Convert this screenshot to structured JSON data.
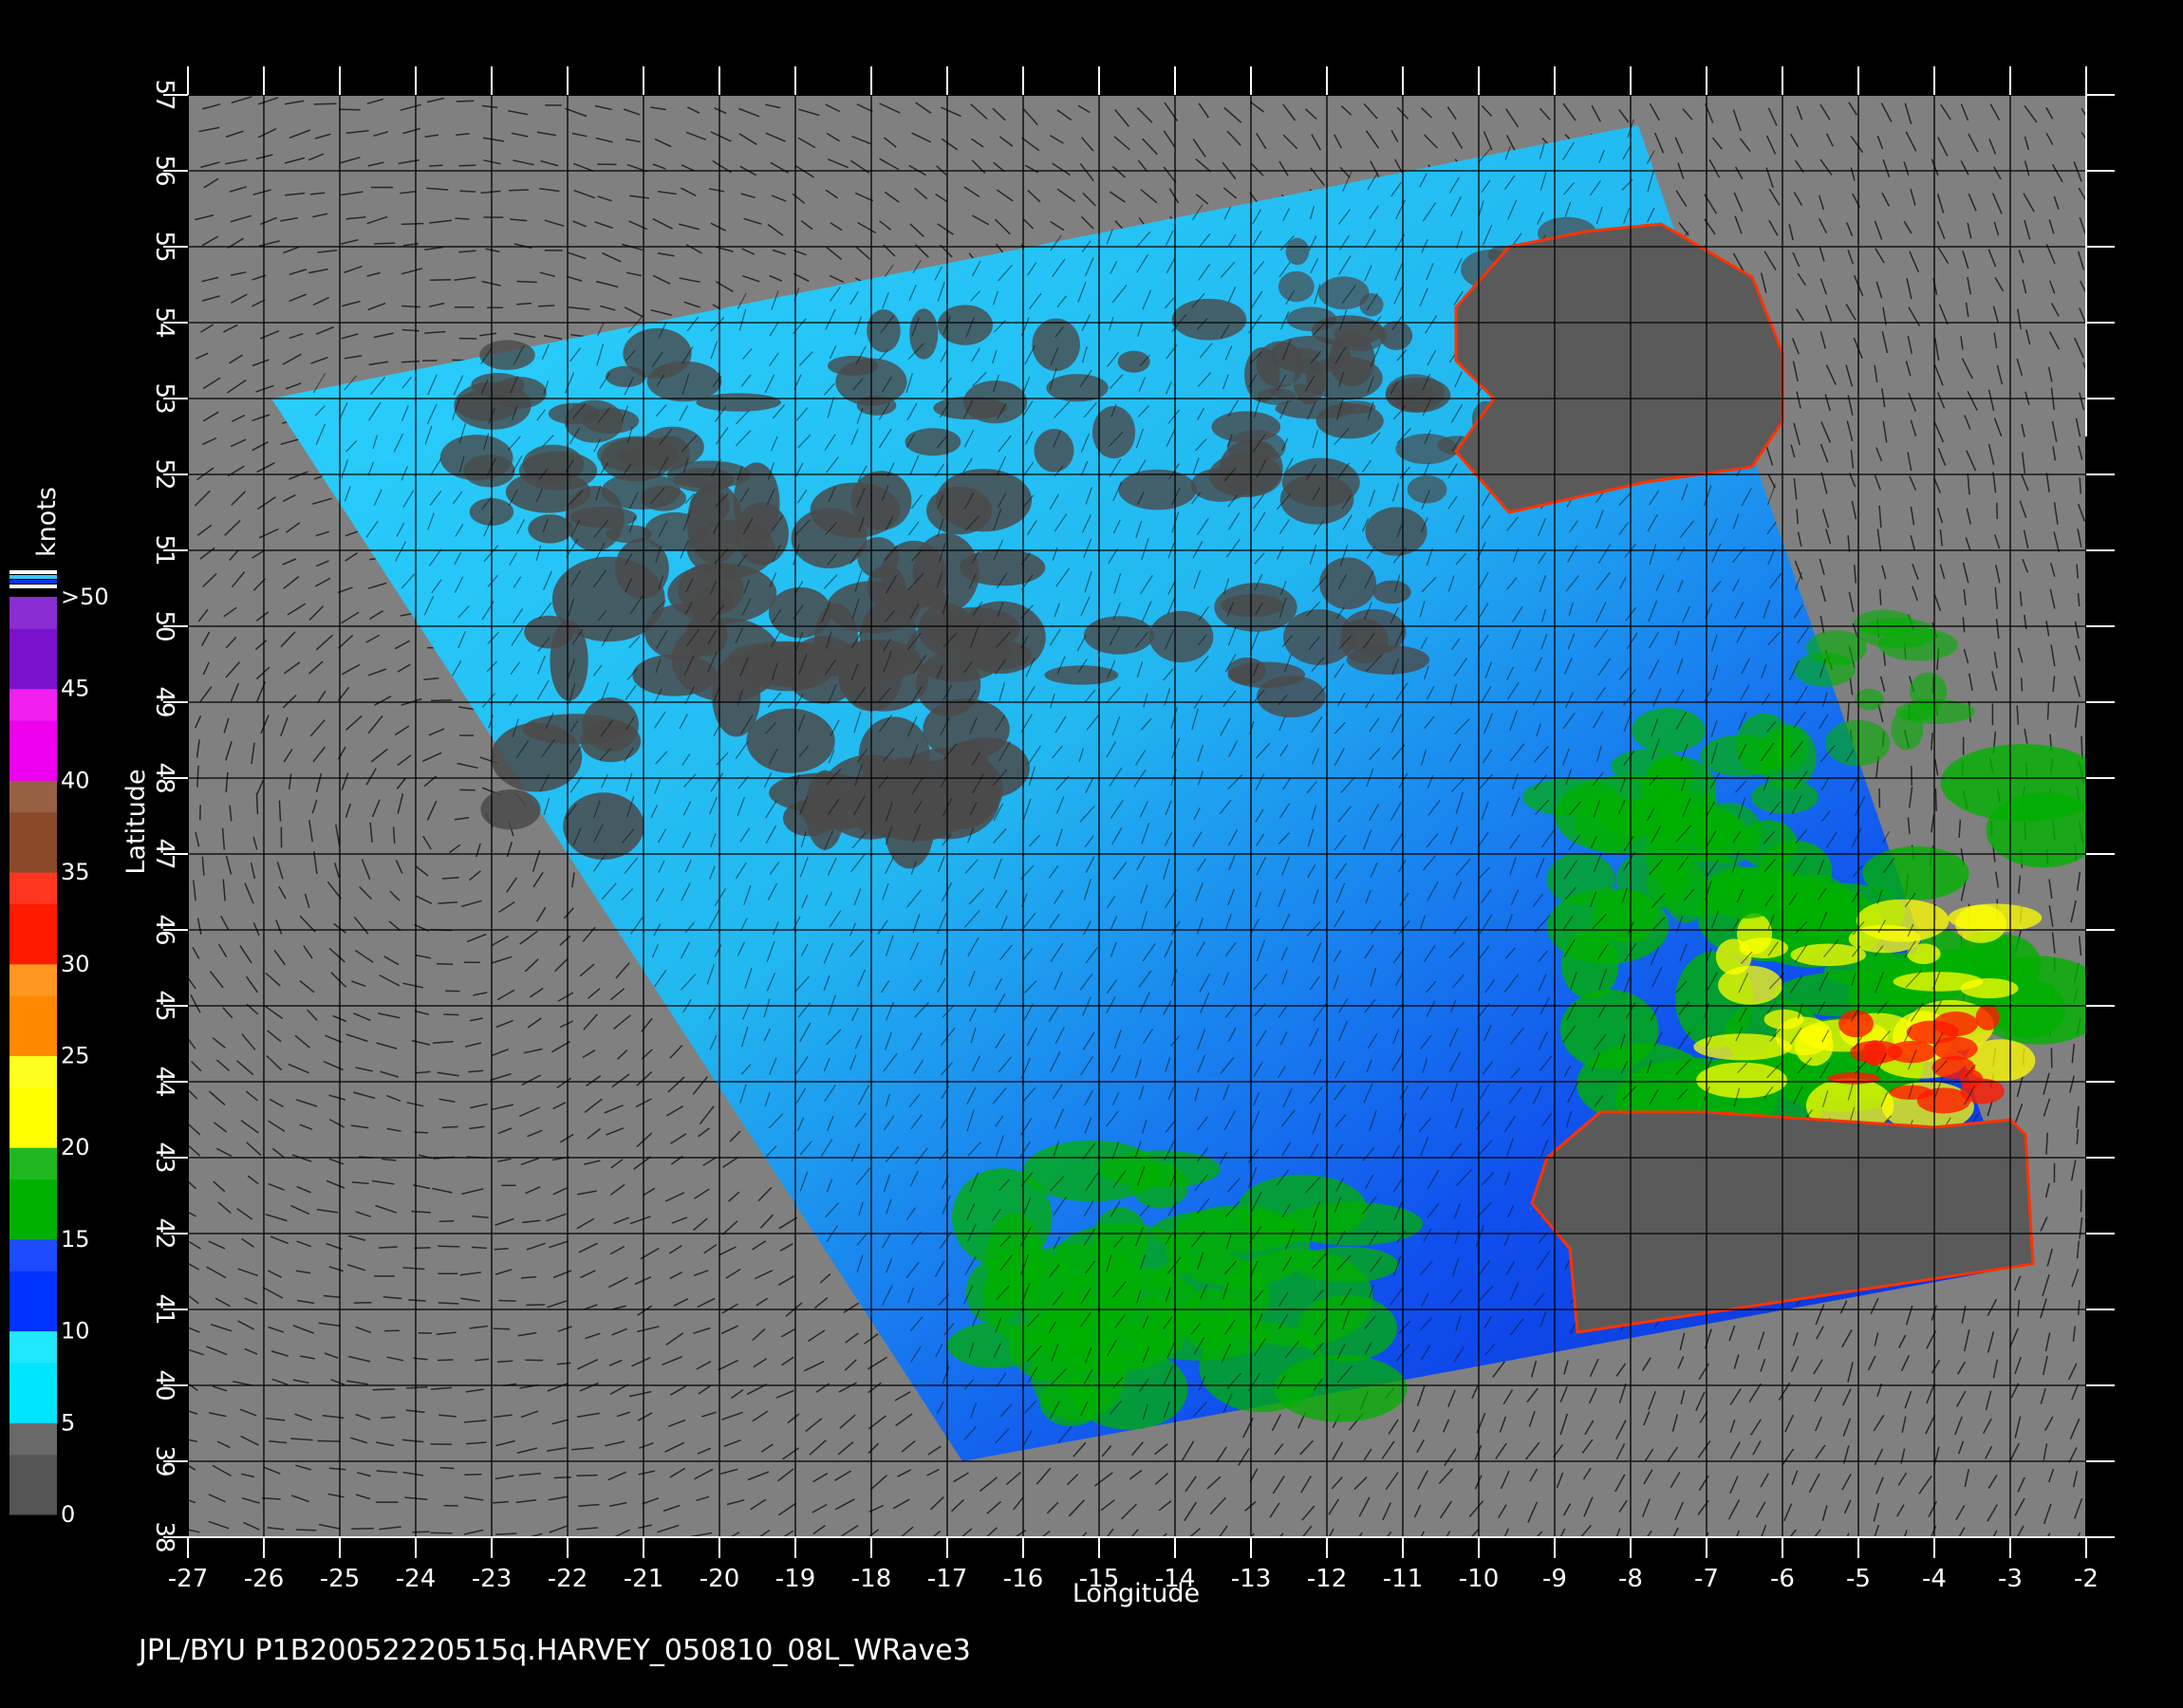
{
  "map": {
    "x_axis": {
      "title": "Longitude",
      "range": [
        -27,
        -2
      ],
      "ticks": [
        "-27",
        "-26",
        "-25",
        "-24",
        "-23",
        "-22",
        "-21",
        "-20",
        "-19",
        "-18",
        "-17",
        "-16",
        "-15",
        "-14",
        "-13",
        "-12",
        "-11",
        "-10",
        "-9",
        "-8",
        "-7",
        "-6",
        "-5",
        "-4",
        "-3",
        "-2"
      ]
    },
    "y_axis": {
      "title": "Latitude",
      "range": [
        38,
        57
      ],
      "ticks": [
        "38",
        "39",
        "40",
        "41",
        "42",
        "43",
        "44",
        "45",
        "46",
        "47",
        "48",
        "49",
        "50",
        "51",
        "52",
        "53",
        "54",
        "55",
        "56",
        "57"
      ]
    },
    "background_color": "#808080",
    "grid": true,
    "swath_corners": [
      {
        "lon": -25.9,
        "lat": 53.0
      },
      {
        "lon": -7.9,
        "lat": 56.6
      },
      {
        "lon": -2.7,
        "lat": 41.6
      },
      {
        "lon": -16.8,
        "lat": 39.0
      }
    ]
  },
  "legend": {
    "unit": "knots",
    "labels": [
      "0",
      "5",
      "10",
      "15",
      "20",
      "25",
      "30",
      "35",
      "40",
      "45",
      ">50"
    ],
    "colors": {
      "0-5": "#555555",
      "5-10": "#00e5ff",
      "10-15": "#0033ff",
      "15-20": "#00b000",
      "20-25": "#ffff00",
      "25-30": "#ff8800",
      "30-35": "#ff1a00",
      "35-40": "#8a4a2a",
      "40-45": "#ee00ee",
      "45-50": "#7a10cc"
    }
  },
  "footer": {
    "caption": "JPL/BYU  P1B20052220515q.HARVEY_050810_08L_WRave3"
  }
}
